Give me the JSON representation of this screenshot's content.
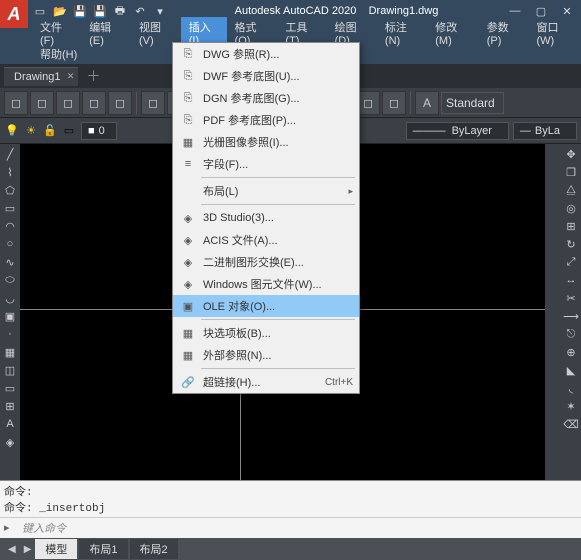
{
  "app": {
    "title_app": "Autodesk AutoCAD 2020",
    "title_doc": "Drawing1.dwg",
    "logo": "A"
  },
  "menubar": {
    "items": [
      {
        "label": "文件(F)"
      },
      {
        "label": "编辑(E)"
      },
      {
        "label": "视图(V)"
      },
      {
        "label": "插入(I)"
      },
      {
        "label": "格式(O)"
      },
      {
        "label": "工具(T)"
      },
      {
        "label": "绘图(D)"
      },
      {
        "label": "标注(N)"
      },
      {
        "label": "修改(M)"
      },
      {
        "label": "参数(P)"
      },
      {
        "label": "窗口(W)"
      }
    ],
    "row2": [
      {
        "label": "帮助(H)"
      }
    ]
  },
  "doctab": {
    "name": "Drawing1"
  },
  "ribbon_combo": {
    "a_label": "A",
    "standard": "Standard"
  },
  "prop": {
    "layer0": "0",
    "bylayer1": "ByLayer",
    "bylayer2": "ByLa"
  },
  "dropdown": {
    "group1": [
      {
        "label": "DWG 参照(R)..."
      },
      {
        "label": "DWF 参考底图(U)..."
      },
      {
        "label": "DGN 参考底图(G)..."
      },
      {
        "label": "PDF 参考底图(P)..."
      },
      {
        "label": "光栅图像参照(I)..."
      },
      {
        "label": "字段(F)..."
      }
    ],
    "layout": {
      "label": "布局(L)"
    },
    "group2": [
      {
        "label": "3D Studio(3)..."
      },
      {
        "label": "ACIS 文件(A)..."
      },
      {
        "label": "二进制图形交换(E)..."
      },
      {
        "label": "Windows 图元文件(W)..."
      },
      {
        "label": "OLE 对象(O)..."
      }
    ],
    "group3": [
      {
        "label": "块选项板(B)..."
      },
      {
        "label": "外部参照(N)..."
      }
    ],
    "hyper": {
      "label": "超链接(H)...",
      "shortcut": "Ctrl+K"
    }
  },
  "cmd": {
    "hist1": "命令:",
    "hist2": "命令: _insertobj",
    "prompt_icon": "▸",
    "placeholder": "键入命令"
  },
  "status_tabs": [
    {
      "label": "模型"
    },
    {
      "label": "布局1"
    },
    {
      "label": "布局2"
    }
  ]
}
